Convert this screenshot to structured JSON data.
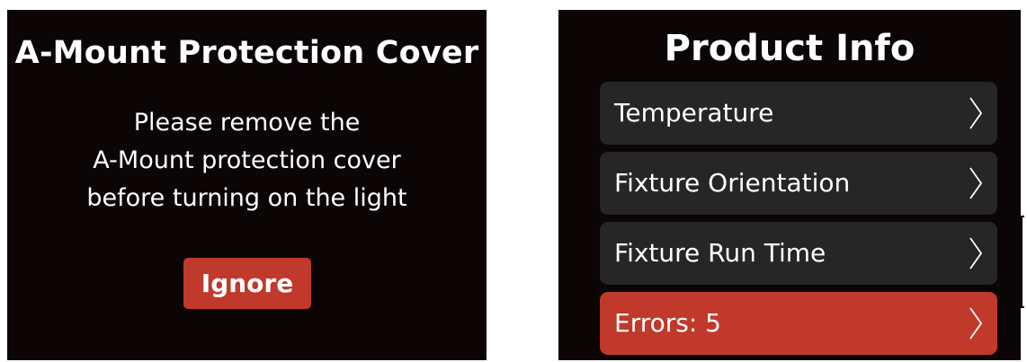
{
  "protection_dialog": {
    "title": "A-Mount Protection Cover",
    "message_lines": [
      "Please remove the",
      "A-Mount protection cover",
      "before turning on the light"
    ],
    "ignore_label": "Ignore"
  },
  "product_info": {
    "title": "Product Info",
    "items": [
      {
        "label": "Temperature",
        "icon": "chevron-right-icon",
        "selected": false
      },
      {
        "label": "Fixture Orientation",
        "icon": "chevron-right-icon",
        "selected": false
      },
      {
        "label": "Fixture Run Time",
        "icon": "chevron-right-icon",
        "selected": false
      },
      {
        "label": "Errors: 5",
        "icon": "chevron-right-icon",
        "selected": true
      }
    ]
  },
  "colors": {
    "screen_background": "#0b0506",
    "menu_item_background": "#262626",
    "accent_red": "#c0392b",
    "text": "#ffffff"
  }
}
